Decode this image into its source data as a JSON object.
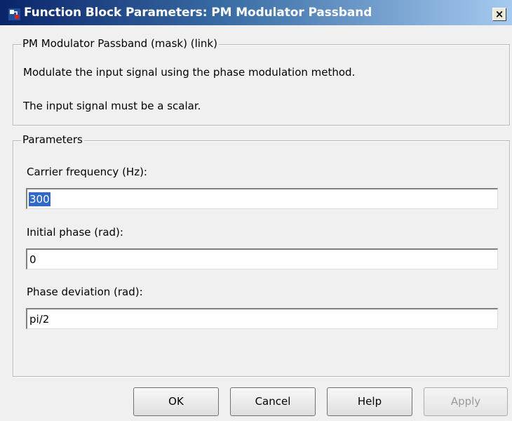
{
  "window": {
    "title": "Function Block Parameters: PM Modulator Passband",
    "close_label": "×"
  },
  "description_group": {
    "legend": "PM Modulator Passband (mask) (link)",
    "line1": "Modulate the input signal using the phase modulation method.",
    "line2": "The input signal must be a scalar."
  },
  "parameters_group": {
    "legend": "Parameters",
    "fields": [
      {
        "label": "Carrier frequency (Hz):",
        "value": "300",
        "selected": true
      },
      {
        "label": "Initial phase (rad):",
        "value": "0",
        "selected": false
      },
      {
        "label": "Phase deviation (rad):",
        "value": "pi/2",
        "selected": false
      }
    ]
  },
  "buttons": {
    "ok": "OK",
    "cancel": "Cancel",
    "help": "Help",
    "apply": "Apply"
  },
  "icons": {
    "window_icon": "simulink-block-icon",
    "close_icon": "close-icon"
  },
  "colors": {
    "title_gradient_start": "#0a246a",
    "title_gradient_end": "#a6caf0",
    "selection": "#3169c6"
  }
}
